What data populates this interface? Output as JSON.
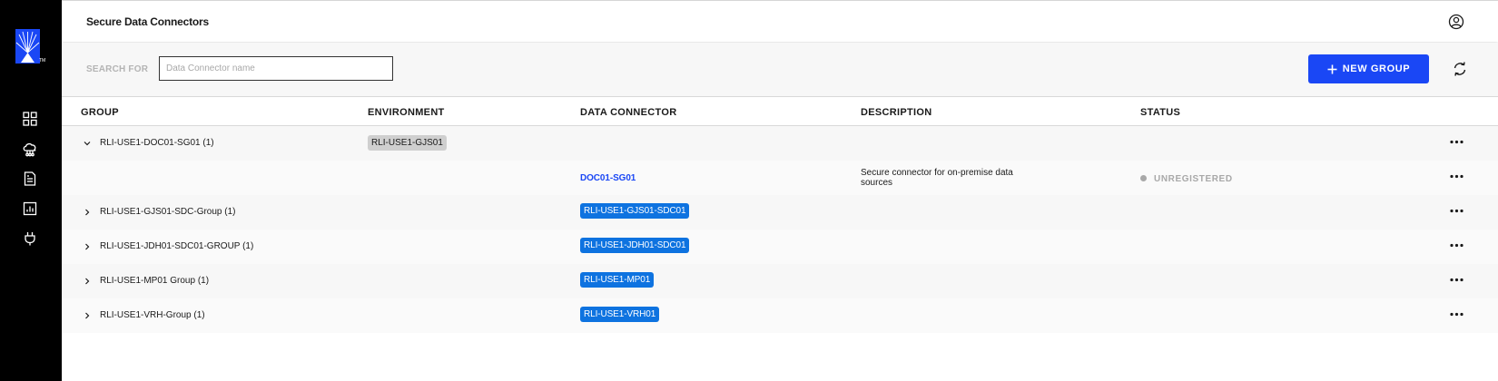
{
  "header": {
    "title": "Secure Data Connectors"
  },
  "brand": {
    "trademark": "TM"
  },
  "toolbar": {
    "search_label": "SEARCH FOR",
    "search_placeholder": "Data Connector name",
    "search_value": "",
    "new_group_label": "NEW GROUP"
  },
  "colors": {
    "accent": "#1a47f5",
    "chip_blue": "#0e73e0",
    "chip_grey": "#cfcfcf",
    "sidebar": "#000000"
  },
  "icons": {
    "sidebar": [
      "dashboard-icon",
      "cloud-network-icon",
      "document-icon",
      "report-chart-icon",
      "plug-icon"
    ],
    "header": "user-account-icon",
    "toolbar": [
      "plus-icon",
      "refresh-icon"
    ],
    "row": [
      "chevron-down-icon",
      "chevron-right-icon",
      "more-options-icon"
    ]
  },
  "table": {
    "columns": {
      "group": "GROUP",
      "environment": "ENVIRONMENT",
      "connector": "DATA CONNECTOR",
      "description": "DESCRIPTION",
      "status": "STATUS"
    },
    "rows": [
      {
        "group": "RLI-USE1-DOC01-SG01 (1)",
        "expanded": true,
        "environment": "RLI-USE1-GJS01",
        "connector": "",
        "description": "",
        "status": ""
      },
      {
        "group": "",
        "environment": "",
        "connector": "DOC01-SG01",
        "description": "Secure connector for on-premise data sources",
        "status": "UNREGISTERED"
      },
      {
        "group": "RLI-USE1-GJS01-SDC-Group (1)",
        "expanded": false,
        "environment": "",
        "connector": "RLI-USE1-GJS01-SDC01",
        "description": "",
        "status": ""
      },
      {
        "group": "RLI-USE1-JDH01-SDC01-GROUP (1)",
        "expanded": false,
        "environment": "",
        "connector": "RLI-USE1-JDH01-SDC01",
        "description": "",
        "status": ""
      },
      {
        "group": "RLI-USE1-MP01 Group (1)",
        "expanded": false,
        "environment": "",
        "connector": "RLI-USE1-MP01",
        "description": "",
        "status": ""
      },
      {
        "group": "RLI-USE1-VRH-Group (1)",
        "expanded": false,
        "environment": "",
        "connector": "RLI-USE1-VRH01",
        "description": "",
        "status": ""
      }
    ]
  }
}
